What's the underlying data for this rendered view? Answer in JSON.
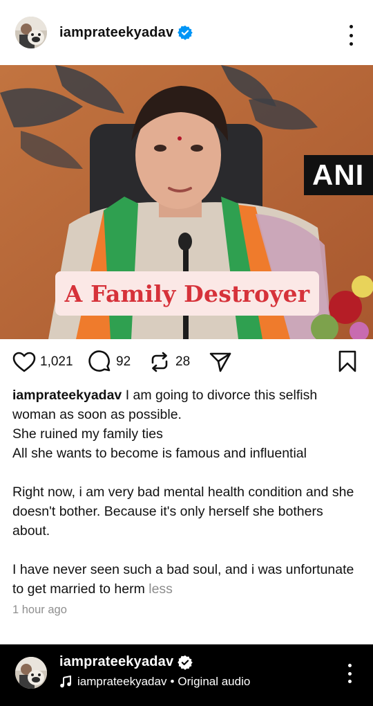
{
  "post": {
    "username": "iamprateekyadav",
    "verified": true,
    "media": {
      "overlay_text": "A Family Destroyer",
      "corner_tag": "ANI"
    },
    "actions": {
      "likes": "1,021",
      "comments": "92",
      "reposts": "28"
    },
    "caption": {
      "username": "iamprateekyadav",
      "text": " I am going to divorce this selfish woman as soon as possible.\nShe ruined my family ties\nAll she wants to become is famous and influential\n\nRight now, i am very bad mental health condition and she doesn't bother. Because it's only herself she bothers about.\n\nI have never seen such a bad soul, and i was unfortunate to get married to herm ",
      "less_label": "less"
    },
    "timestamp": "1 hour ago"
  },
  "bottom_bar": {
    "username": "iamprateekyadav",
    "audio_user": "iamprateekyadav",
    "audio_separator": "•",
    "audio_label": "Original audio"
  },
  "colors": {
    "verified_blue": "#0095f6",
    "overlay_red": "#d6323a",
    "overlay_bg": "#fbe8e6",
    "muted": "#8e8e8e"
  },
  "icons": [
    "verified-badge-icon",
    "more-options-icon",
    "heart-icon",
    "comment-icon",
    "repost-icon",
    "share-icon",
    "bookmark-icon",
    "music-note-icon"
  ]
}
